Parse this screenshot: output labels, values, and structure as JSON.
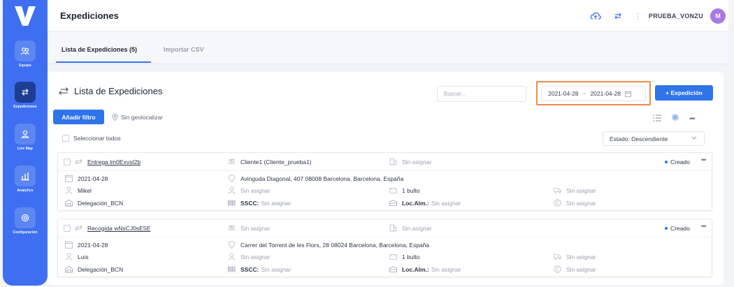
{
  "header": {
    "title": "Expediciones",
    "user": "PRUEBA_VONZU",
    "avatar_letter": "M"
  },
  "sidebar": {
    "items": [
      {
        "label": "Equipo",
        "icon": "team-icon"
      },
      {
        "label": "Expediciones",
        "icon": "transfer-icon"
      },
      {
        "label": "Live Map",
        "icon": "map-icon"
      },
      {
        "label": "Analytics",
        "icon": "chart-icon"
      },
      {
        "label": "Configuración",
        "icon": "gear-icon"
      }
    ]
  },
  "tabs": [
    {
      "label": "Lista de Expediciones (5)",
      "active": true
    },
    {
      "label": "Importar CSV",
      "active": false
    }
  ],
  "list": {
    "title": "Lista de Expediciones",
    "search_placeholder": "Buscar...",
    "date_from": "2021-04-28",
    "date_sep": "~",
    "date_to": "2021-04-28",
    "new_button": "+ Expedición",
    "add_filter": "Añadir filtro",
    "geo_filter": "Sin geolocalizar",
    "select_all": "Seleccionar todos",
    "sort": "Estado: Descendiente"
  },
  "shipments": [
    {
      "ref": "Entrega lm0Exvst2b",
      "client": "Cliente1 (Cliente_prueba1)",
      "assign": "Sin asignar",
      "status": "Creado",
      "date": "2021-04-28",
      "address": "Avinguda Diagonal, 407 08008 Barcelona, Barcelona, España",
      "person": "Mikel",
      "driver": "Sin asignar",
      "packages": "1 bulto",
      "vehicle": "Sin asignar",
      "branch": "Delegación_BCN",
      "sscc_label": "SSCC:",
      "sscc": "Sin asignar",
      "loc_label": "Loc.Alm.:",
      "loc": "Sin asignar",
      "price": "Sin asignar"
    },
    {
      "ref": "Recogida wNsCJ0sE5E",
      "client": "Sin asignar",
      "assign": "Sin asignar",
      "status": "Creado",
      "date": "2021-04-28",
      "address": "Carrer del Torrent de les Flors, 28 08024 Barcelona, Barcelona, España",
      "person": "Luis",
      "driver": "Sin asignar",
      "packages": "1 bulto",
      "vehicle": "Sin asignar",
      "branch": "Delegación_BCN",
      "sscc_label": "SSCC:",
      "sscc": "Sin asignar",
      "loc_label": "Loc.Alm.:",
      "loc": "Sin asignar",
      "price": "Sin asignar"
    }
  ],
  "colors": {
    "primary": "#3d6ff0",
    "button": "#2f74e8",
    "highlight": "#f08a4b",
    "avatar": "#a97ae2"
  }
}
